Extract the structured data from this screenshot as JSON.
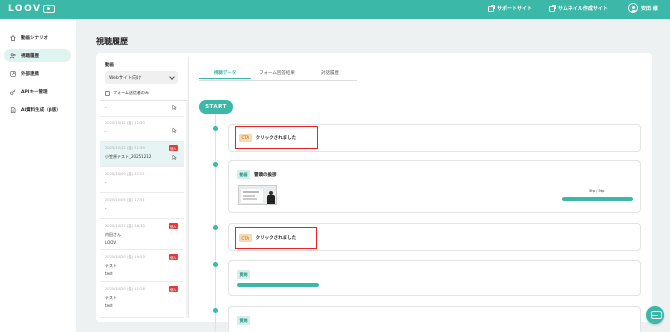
{
  "app": {
    "logo_text": "LOOV",
    "header_links": [
      {
        "label": "サポートサイト"
      },
      {
        "label": "サムネイル作成サイト"
      }
    ],
    "user_name": "安田 様"
  },
  "sidebar": {
    "items": [
      {
        "label": "動画シナリオ",
        "icon": "home-icon",
        "active": false
      },
      {
        "label": "視聴履歴",
        "icon": "users-icon",
        "active": true
      },
      {
        "label": "外部連携",
        "icon": "link-icon",
        "active": false
      },
      {
        "label": "APIキー管理",
        "icon": "key-icon",
        "active": false
      },
      {
        "label": "AI資料生成（β版）",
        "icon": "document-icon",
        "active": false
      }
    ]
  },
  "page": {
    "title": "視聴履歴"
  },
  "filter": {
    "video_label": "動画",
    "video_selected": "Webサイト向け",
    "checkbox_label": "フォーム送信者のみ",
    "checkbox_checked": false
  },
  "entries": [
    {
      "date": "",
      "name": "-",
      "sub": "",
      "badge": "",
      "cursor": true,
      "active": false
    },
    {
      "date": "2025/10/12 (金) 12:30",
      "name": "-",
      "sub": "",
      "badge": "",
      "cursor": true,
      "active": false
    },
    {
      "date": "2025/10/12 (金) 11:59",
      "name": "小笠原テスト_20251212",
      "sub": "",
      "badge": "個人",
      "cursor": true,
      "active": true
    },
    {
      "date": "2025/10/09 (金) 17:01",
      "name": "-",
      "sub": "",
      "badge": "",
      "cursor": false,
      "active": false
    },
    {
      "date": "2025/10/05 (金) 17:51",
      "name": "-",
      "sub": "",
      "badge": "",
      "cursor": false,
      "active": false
    },
    {
      "date": "2025/10/21 (金) 16:30",
      "name": "内田さん",
      "sub": "LOOV",
      "badge": "個人",
      "cursor": false,
      "active": false
    },
    {
      "date": "2025/10/20 (金) 19:53",
      "name": "テスト",
      "sub": "test",
      "badge": "個人",
      "cursor": false,
      "active": false
    },
    {
      "date": "2025/10/20 (金) 17:28",
      "name": "テスト",
      "sub": "test",
      "badge": "個人",
      "cursor": false,
      "active": false
    }
  ],
  "tabs": [
    {
      "label": "視聴データ",
      "active": true
    },
    {
      "label": "フォーム回答結果",
      "active": false
    },
    {
      "label": "対話履歴",
      "active": false
    }
  ],
  "timeline": {
    "start_label": "START",
    "events": [
      {
        "type": "cta",
        "tag": "CTA",
        "text": "クリックされました"
      },
      {
        "type": "video",
        "tag": "動画",
        "text": "冒頭の挨拶",
        "progress_label": "5tp / 5tp",
        "progress": 1.0
      },
      {
        "type": "cta",
        "tag": "CTA",
        "text": "クリックされました"
      },
      {
        "type": "question",
        "tag": "質問",
        "progress": 1.0
      },
      {
        "type": "question",
        "tag": "質問"
      }
    ]
  },
  "colors": {
    "accent": "#3bb8a7",
    "highlight": "#e22222"
  }
}
